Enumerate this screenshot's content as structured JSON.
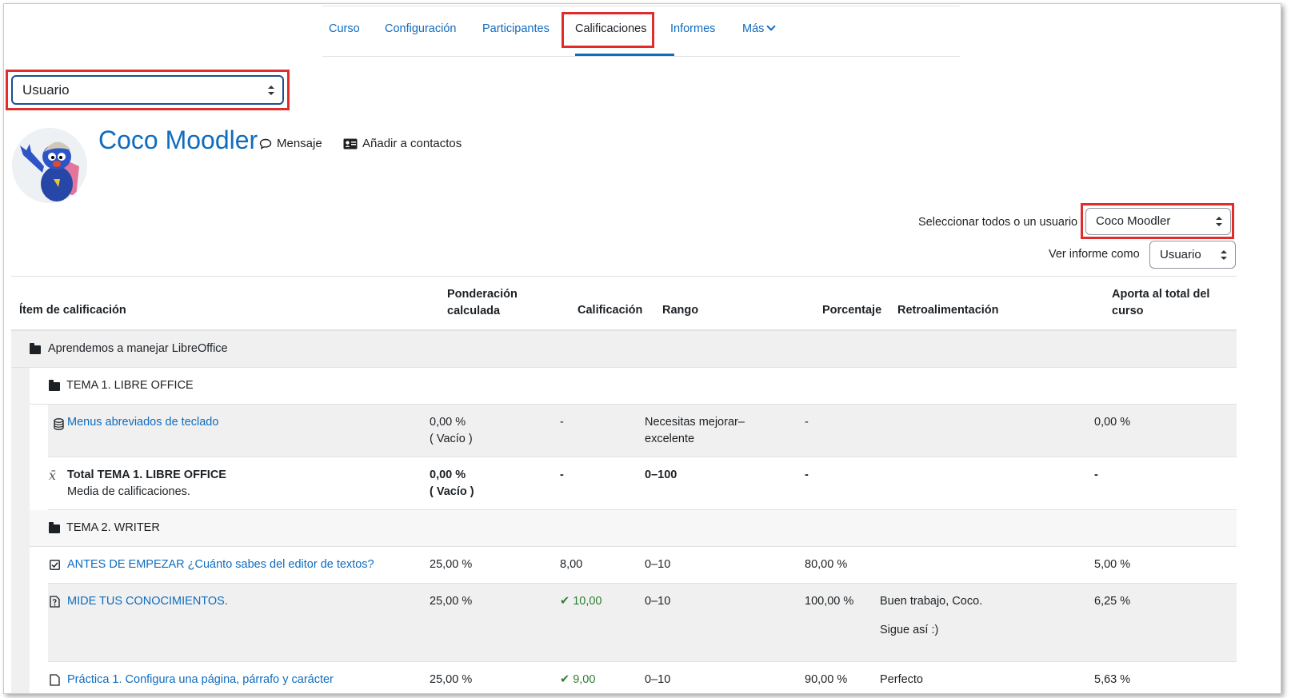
{
  "nav": {
    "tabs": [
      {
        "label": "Curso"
      },
      {
        "label": "Configuración"
      },
      {
        "label": "Participantes"
      },
      {
        "label": "Calificaciones"
      },
      {
        "label": "Informes"
      },
      {
        "label": "Más"
      }
    ],
    "active_tab": "Calificaciones"
  },
  "report_selector": {
    "value": "Usuario"
  },
  "user": {
    "name": "Coco Moodler",
    "message_label": "Mensaje",
    "add_contact_label": "Añadir a contactos"
  },
  "filters": {
    "select_user_label": "Seleccionar todos o un usuario",
    "select_user_value": "Coco Moodler",
    "view_as_label": "Ver informe como",
    "view_as_value": "Usuario"
  },
  "table": {
    "headers": {
      "item": "Ítem de calificación",
      "weight": "Ponderación calculada",
      "grade": "Calificación",
      "range": "Rango",
      "percent": "Porcentaje",
      "feedback": "Retroalimentación",
      "contrib": "Aporta al total del curso"
    },
    "course": "Aprendemos a manejar LibreOffice",
    "cat1": {
      "name": "TEMA 1. LIBRE OFFICE",
      "item": {
        "name": "Menus abreviados de teclado",
        "weight": "0,00 %",
        "weight_note": "( Vacío )",
        "grade": "-",
        "range": "Necesitas mejorar–excelente",
        "percent": "-",
        "contrib": "0,00 %"
      },
      "total": {
        "name": "Total TEMA 1. LIBRE OFFICE",
        "sub": "Media de calificaciones.",
        "weight": "0,00 %",
        "weight_note": "( Vacío )",
        "grade": "-",
        "range": "0–100",
        "percent": "-",
        "contrib": "-"
      }
    },
    "cat2": {
      "name": "TEMA 2. WRITER",
      "items": [
        {
          "name": "ANTES DE EMPEZAR ¿Cuánto sabes del editor de textos?",
          "weight": "25,00 %",
          "grade": "8,00",
          "range": "0–10",
          "percent": "80,00 %",
          "feedback": "",
          "contrib": "5,00 %"
        },
        {
          "name": "MIDE TUS CONOCIMIENTOS.",
          "weight": "25,00 %",
          "grade": "10,00",
          "range": "0–10",
          "percent": "100,00 %",
          "feedback": "Buen trabajo, Coco.",
          "feedback2": "Sigue así :)",
          "contrib": "6,25 %"
        },
        {
          "name": "Práctica 1. Configura una página, párrafo y carácter",
          "weight": "25,00 %",
          "grade": "9,00",
          "range": "0–10",
          "percent": "90,00 %",
          "feedback": "Perfecto",
          "contrib": "5,63 %"
        }
      ]
    }
  }
}
